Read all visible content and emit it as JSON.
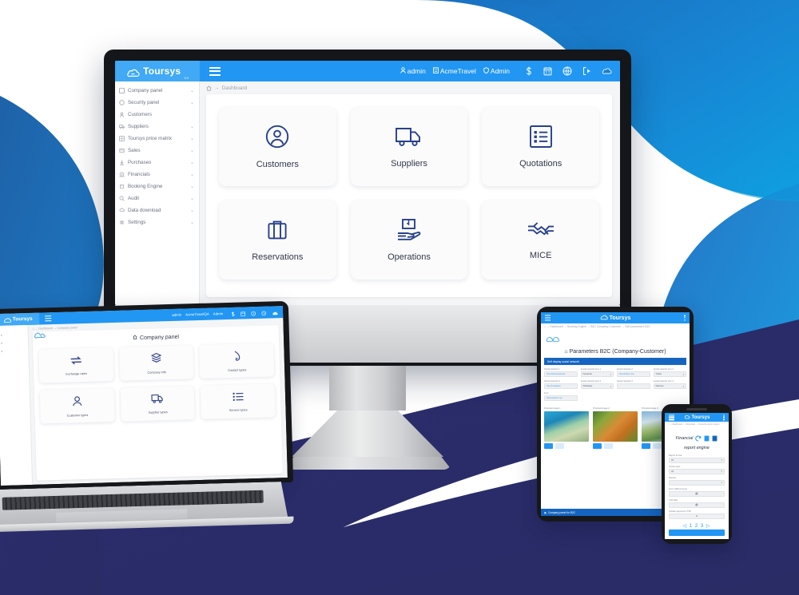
{
  "brand": {
    "name": "Toursys",
    "sub": "3.0",
    "logo_icon": "cloud-icon"
  },
  "colors": {
    "accent_blue": "#2196f3",
    "brand_blue": "#41a9f5",
    "deep_navy": "#2b2d6e",
    "mid_blue": "#1565c0",
    "icon_navy": "#27408b"
  },
  "background": {
    "shapes": [
      {
        "name": "top-right-blue-wave",
        "color": "#1787d4"
      },
      {
        "name": "left-blue-block",
        "color": "#1b63ad"
      },
      {
        "name": "bottom-navy-wedge",
        "color": "#2b2d6e"
      }
    ]
  },
  "desktop": {
    "topbar": {
      "hamburger_icon": "hamburger-icon",
      "user": {
        "label": "admin",
        "icon": "user-icon"
      },
      "company": {
        "label": "AcmeTravel",
        "icon": "building-icon"
      },
      "role": {
        "label": "Admin",
        "icon": "shield-icon"
      },
      "icons": [
        "dollar-icon",
        "calendar-icon",
        "globe-icon",
        "logout-icon",
        "cloud-icon"
      ]
    },
    "breadcrumb": {
      "home_icon": "home-icon",
      "separator": "→",
      "current": "Dashboard"
    },
    "sidebar": {
      "items": [
        {
          "label": "Company panel",
          "icon": "building-icon",
          "chevron": "⌄"
        },
        {
          "label": "Security panel",
          "icon": "shield-icon",
          "chevron": "⌄"
        },
        {
          "label": "Customers",
          "icon": "user-icon",
          "chevron": ""
        },
        {
          "label": "Suppliers",
          "icon": "truck-icon",
          "chevron": "⌄"
        },
        {
          "label": "Toursys price matrix",
          "icon": "grid-icon",
          "chevron": "⌄"
        },
        {
          "label": "Sales",
          "icon": "cart-icon",
          "chevron": "⌄"
        },
        {
          "label": "Purchases",
          "icon": "download-icon",
          "chevron": "⌄"
        },
        {
          "label": "Financials",
          "icon": "bank-icon",
          "chevron": "⌄"
        },
        {
          "label": "Booking Engine",
          "icon": "engine-icon",
          "chevron": "⌄"
        },
        {
          "label": "Audit",
          "icon": "search-icon",
          "chevron": "⌄"
        },
        {
          "label": "Data download",
          "icon": "cloud-download-icon",
          "chevron": "⌄"
        },
        {
          "label": "Settings",
          "icon": "gear-icon",
          "chevron": "⌄"
        }
      ]
    },
    "tiles": [
      {
        "label": "Customers",
        "icon": "user-circle-icon"
      },
      {
        "label": "Suppliers",
        "icon": "truck-icon"
      },
      {
        "label": "Quotations",
        "icon": "list-icon"
      },
      {
        "label": "Reservations",
        "icon": "suitcase-icon"
      },
      {
        "label": "Operations",
        "icon": "package-hand-icon"
      },
      {
        "label": "MICE",
        "icon": "handshake-icon"
      }
    ]
  },
  "laptop": {
    "topbar": {
      "user": "admin",
      "company": "AcmeTravelQA",
      "role": "Admin",
      "icons": [
        "dollar-icon",
        "calendar-icon",
        "info-icon",
        "clock-icon",
        "cloud-icon"
      ]
    },
    "breadcrumb": "⌂ → Dashboard → Company panel",
    "panel_title": "Company panel",
    "panel_title_icon": "home-icon",
    "tiles": [
      {
        "label": "Exchange rates",
        "icon": "exchange-icon"
      },
      {
        "label": "Company info",
        "icon": "layers-icon"
      },
      {
        "label": "Contact types",
        "icon": "phone-icon"
      },
      {
        "label": "Customer types",
        "icon": "user-icon"
      },
      {
        "label": "Supplier types",
        "icon": "truck-icon"
      },
      {
        "label": "Service types",
        "icon": "list-icon"
      }
    ]
  },
  "tablet": {
    "breadcrumb": "⌂ → Dashboard → Booking Engine → B2C Company-Customer → Self parameters B2C",
    "title": "Parameters B2C (Company-Customer)",
    "title_icon": "home-icon",
    "section_bar": "Self display social network",
    "fields": [
      {
        "label": "Social network 1",
        "value": "http://www.facebook",
        "type": "text"
      },
      {
        "label": "Social network icon 1",
        "value": "Facebook",
        "type": "select"
      },
      {
        "label": "Social network 2",
        "value": "http://twitter.com",
        "type": "text"
      },
      {
        "label": "Social network icon 2",
        "value": "Twitter",
        "type": "select"
      },
      {
        "label": "Social network 3",
        "value": "http://instagram",
        "type": "text"
      },
      {
        "label": "Social network icon 3",
        "value": "Whatsapp",
        "type": "select"
      },
      {
        "label": "Social network 4",
        "value": "",
        "type": "text"
      },
      {
        "label": "Social network icon 4",
        "value": "Webcam",
        "type": "select"
      }
    ],
    "extra_field": {
      "label": "Font",
      "value": "Reservations net"
    },
    "images": [
      {
        "label": "Principal image 1",
        "art": "img-beach",
        "buttons": [
          "upload-icon",
          "trash-icon"
        ]
      },
      {
        "label": "Principal image 2",
        "art": "img-tiger",
        "buttons": [
          "upload-icon",
          "trash-icon"
        ]
      },
      {
        "label": "Principal image 3",
        "art": "img-boats",
        "buttons": [
          "upload-icon",
          "trash-icon"
        ]
      }
    ],
    "footer": {
      "label": "Company panel for B2C",
      "icon": "building-icon"
    }
  },
  "phone": {
    "breadcrumb": "⌂ → Dashboard → Financials → Financial report engine",
    "title_line1": "Financial",
    "title_line2": "report engine",
    "title_icons": [
      "refresh-icon",
      "excel-icon",
      "pdf-icon"
    ],
    "fields": [
      {
        "label": "Report format",
        "value": "All",
        "type": "select"
      },
      {
        "label": "Invoice type",
        "value": "All",
        "type": "select"
      },
      {
        "label": "Results",
        "value": "",
        "type": "select"
      },
      {
        "label": "From (dd/mm/yyyy)",
        "value": "🗓",
        "type": "date"
      },
      {
        "label": "Until date",
        "value": "🗓",
        "type": "date"
      },
      {
        "label": "Include payments (Y/N)",
        "value": "N",
        "type": "select"
      }
    ],
    "pager": "◁ 1 2 3 ▷",
    "submit_label": ""
  }
}
